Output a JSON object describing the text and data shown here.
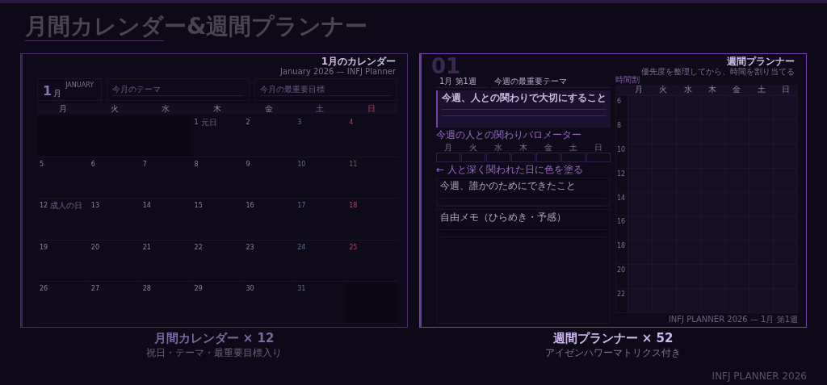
{
  "title": "月間カレンダー&週間プランナー",
  "monthly": {
    "heading": "1月のカレンダー",
    "subheading": "January 2026 — INFJ Planner",
    "month_number": "1",
    "month_kanji": "月",
    "month_name": "JANUARY",
    "fields": [
      {
        "placeholder": "今月のテーマ"
      },
      {
        "placeholder": "今月の最重要目標"
      }
    ],
    "weekdays": [
      {
        "label": "月",
        "kind": "weekday"
      },
      {
        "label": "火",
        "kind": "weekday"
      },
      {
        "label": "水",
        "kind": "weekday"
      },
      {
        "label": "木",
        "kind": "weekday"
      },
      {
        "label": "金",
        "kind": "weekday"
      },
      {
        "label": "土",
        "kind": "saturday"
      },
      {
        "label": "日",
        "kind": "sunday"
      }
    ],
    "weeks": [
      [
        {
          "kind": "empty"
        },
        {
          "kind": "empty"
        },
        {
          "kind": "empty"
        },
        {
          "day": "1",
          "note": "元日",
          "kind": "weekday"
        },
        {
          "day": "2",
          "kind": "weekday"
        },
        {
          "day": "3",
          "kind": "saturday"
        },
        {
          "day": "4",
          "kind": "sunday"
        }
      ],
      [
        {
          "day": "5",
          "kind": "weekday"
        },
        {
          "day": "6",
          "kind": "weekday"
        },
        {
          "day": "7",
          "kind": "weekday"
        },
        {
          "day": "8",
          "kind": "weekday"
        },
        {
          "day": "9",
          "kind": "weekday"
        },
        {
          "day": "10",
          "kind": "saturday"
        },
        {
          "day": "11",
          "kind": "sunday"
        }
      ],
      [
        {
          "day": "12",
          "note": "成人の日",
          "kind": "weekday"
        },
        {
          "day": "13",
          "kind": "weekday"
        },
        {
          "day": "14",
          "kind": "weekday"
        },
        {
          "day": "15",
          "kind": "weekday"
        },
        {
          "day": "16",
          "kind": "weekday"
        },
        {
          "day": "17",
          "kind": "saturday"
        },
        {
          "day": "18",
          "kind": "sunday"
        }
      ],
      [
        {
          "day": "19",
          "kind": "weekday"
        },
        {
          "day": "20",
          "kind": "weekday"
        },
        {
          "day": "21",
          "kind": "weekday"
        },
        {
          "day": "22",
          "kind": "weekday"
        },
        {
          "day": "23",
          "kind": "weekday"
        },
        {
          "day": "24",
          "kind": "saturday"
        },
        {
          "day": "25",
          "kind": "sunday"
        }
      ],
      [
        {
          "day": "26",
          "kind": "weekday"
        },
        {
          "day": "27",
          "kind": "weekday"
        },
        {
          "day": "28",
          "kind": "weekday"
        },
        {
          "day": "29",
          "kind": "weekday"
        },
        {
          "day": "30",
          "kind": "weekday"
        },
        {
          "day": "31",
          "kind": "saturday"
        },
        {
          "kind": "empty"
        }
      ]
    ],
    "caption": {
      "title": "月間カレンダー × 12",
      "subtitle": "祝日・テーマ・最重要目標入り",
      "selected": false
    }
  },
  "weekly": {
    "big_number": "01",
    "heading": "週間プランナー",
    "subheading": "優先度を整理してから、時間を割り当てる",
    "week_label": "1月 第1週",
    "theme_label": "今週の最重要テーマ",
    "focus_title": "今週、人との関わりで大切にすること",
    "barometer": {
      "title": "今週の人との関わりバロメーター",
      "days": [
        "月",
        "火",
        "水",
        "木",
        "金",
        "土",
        "日"
      ],
      "hint": "← 人と深く関われた日に色を塗る"
    },
    "boxes": [
      {
        "title": "今週、誰かのためにできたこと"
      },
      {
        "title": "自由メモ（ひらめき・予感）"
      }
    ],
    "schedule": {
      "title": "時間割",
      "days": [
        "月",
        "火",
        "水",
        "木",
        "金",
        "土",
        "日"
      ],
      "hours": [
        "6",
        "8",
        "10",
        "12",
        "14",
        "16",
        "18",
        "20",
        "22"
      ]
    },
    "footer": "INFJ PLANNER 2026 — 1月 第1週",
    "caption": {
      "title": "週間プランナー × 52",
      "subtitle": "アイゼンハワーマトリクス付き",
      "selected": true
    }
  },
  "brand": "INFJ PLANNER 2026"
}
